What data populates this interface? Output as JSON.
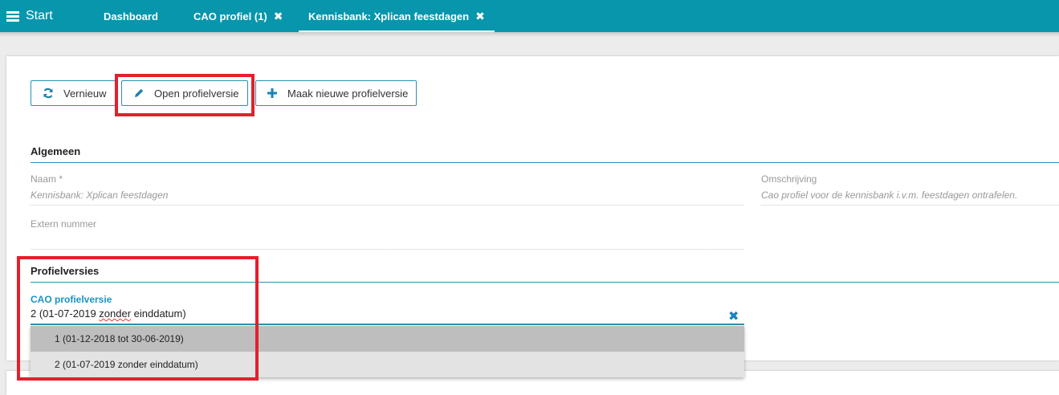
{
  "topbar": {
    "start_label": "Start",
    "tabs": [
      {
        "label": "Dashboard",
        "closable": false
      },
      {
        "label": "CAO profiel (1)",
        "closable": true,
        "close_glyph": "✖"
      },
      {
        "label": "Kennisbank: Xplican feestdagen",
        "closable": true,
        "active": true,
        "close_glyph": "✖"
      }
    ],
    "accent": "#0796ac"
  },
  "toolbar": {
    "refresh_label": "Vernieuw",
    "refresh_icon": "refresh-icon",
    "open_label": "Open profielversie",
    "open_icon": "pencil-icon",
    "new_label": "Maak nieuwe profielversie",
    "new_icon": "plus-icon"
  },
  "algemeen": {
    "title": "Algemeen",
    "naam_label": "Naam *",
    "naam_value": "Kennisbank: Xplican feestdagen",
    "omschrijving_label": "Omschrijving",
    "omschrijving_value": "Cao profiel voor de kennisbank i.v.m. feestdagen ontrafelen.",
    "extern_label": "Extern nummer",
    "extern_value": ""
  },
  "profielversies": {
    "title": "Profielversies",
    "field_label": "CAO profielversie",
    "selected_prefix": "2 (01-07-2019 ",
    "selected_misspelled": "zonder",
    "selected_suffix": " einddatum)",
    "clear_glyph": "✖",
    "options": [
      "1 (01-12-2018 tot 30-06-2019)",
      "2 (01-07-2019 zonder einddatum)"
    ]
  },
  "highlight_color": "#e3202b"
}
